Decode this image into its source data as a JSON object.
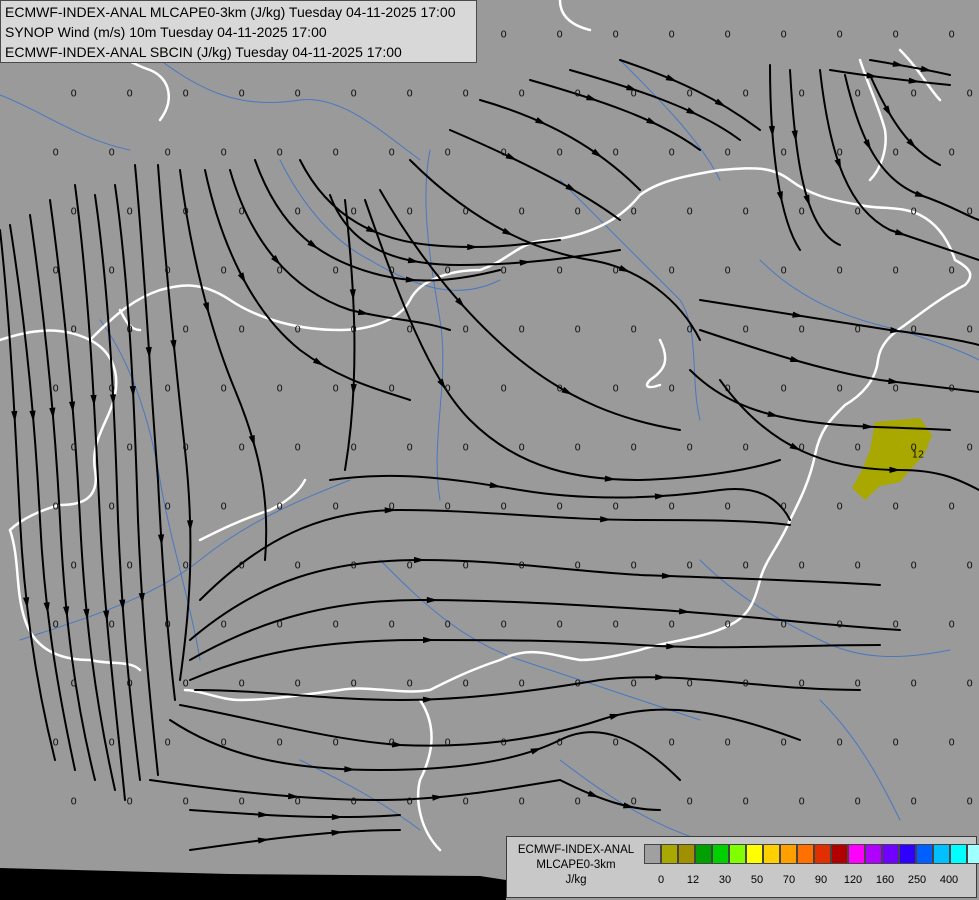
{
  "titles": [
    "ECMWF-INDEX-ANAL MLCAPE0-3km (J/kg) Tuesday 04-11-2025 17:00",
    "SYNOP Wind (m/s) 10m Tuesday 04-11-2025 17:00",
    "ECMWF-INDEX-ANAL SBCIN (J/kg) Tuesday 04-11-2025 17:00"
  ],
  "legend": {
    "model": "ECMWF-INDEX-ANAL",
    "parameter": "MLCAPE0-3km",
    "unit": "J/kg",
    "colors": [
      "#a0a0a0",
      "#a8a800",
      "#a09000",
      "#00a000",
      "#00d000",
      "#80ff00",
      "#ffff00",
      "#ffd000",
      "#ffa000",
      "#ff7000",
      "#e03000",
      "#b00000",
      "#ff00ff",
      "#b000ff",
      "#7000ff",
      "#3000ff",
      "#0060ff",
      "#00c0ff",
      "#00ffff",
      "#a0ffff",
      "#ffffff"
    ],
    "tick_labels": [
      "0",
      "12",
      "30",
      "50",
      "70",
      "90",
      "120",
      "160",
      "250",
      "400"
    ]
  },
  "map": {
    "colors": {
      "background": "#9a9a9a",
      "border": "#ffffff",
      "river": "#4a78c0",
      "streamline": "#000000",
      "cape_patch": "#a8a800",
      "sea": "#000000"
    },
    "station_value": "0",
    "cape_area_value": "12"
  }
}
